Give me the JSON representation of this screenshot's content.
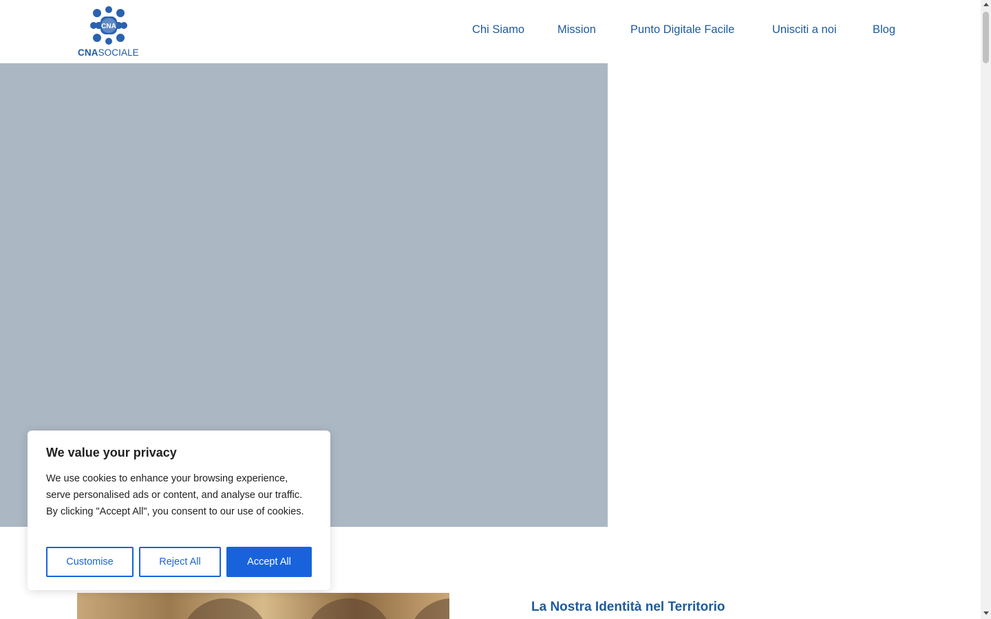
{
  "header": {
    "logo": {
      "mark_text": "CNA",
      "wordmark_bold": "CNA",
      "wordmark_light": "SOCIALE",
      "icon": "cna-sociale-logo-icon"
    },
    "nav": [
      {
        "label": "Chi Siamo"
      },
      {
        "label": "Mission"
      },
      {
        "label": "Punto Digitale Facile"
      },
      {
        "label": "Unisciti a noi"
      },
      {
        "label": "Blog"
      }
    ]
  },
  "main": {
    "section_title": "La Nostra Identità nel Territorio"
  },
  "cookie_banner": {
    "title": "We value your privacy",
    "text": "We use cookies to enhance your browsing experience, serve personalised ads or content, and analyse our traffic. By clicking \"Accept All\", you consent to our use of cookies.",
    "buttons": {
      "customise": "Customise",
      "reject": "Reject All",
      "accept": "Accept All"
    }
  },
  "colors": {
    "brand": "#1e5a9e",
    "hero_placeholder": "#abb7c3",
    "cookie_accent": "#1863dc",
    "text_dark": "#212121"
  }
}
